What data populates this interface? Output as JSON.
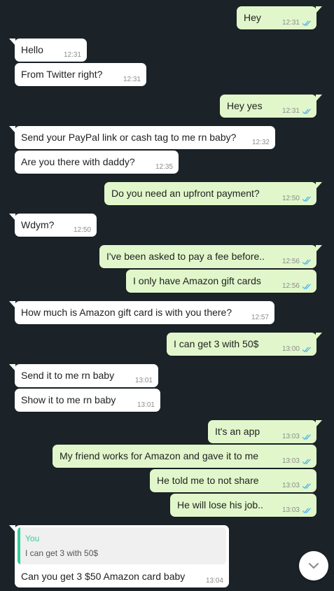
{
  "messages": [
    {
      "dir": "out",
      "text": "Hey",
      "time": "12:31",
      "read": true
    },
    {
      "dir": "in",
      "text": "Hello",
      "time": "12:31"
    },
    {
      "dir": "in",
      "text": "From Twitter right?",
      "time": "12:31"
    },
    {
      "dir": "out",
      "text": "Hey yes",
      "time": "12:31",
      "read": true
    },
    {
      "dir": "in",
      "text": "Send your PayPal link or cash tag to me rn baby?",
      "time": "12:32"
    },
    {
      "dir": "in",
      "text": "Are you there with daddy?",
      "time": "12:35"
    },
    {
      "dir": "out",
      "text": "Do you need an upfront payment?",
      "time": "12:50",
      "read": true
    },
    {
      "dir": "in",
      "text": "Wdym?",
      "time": "12:50"
    },
    {
      "dir": "out",
      "text": "I've been asked to pay a fee before..",
      "time": "12:56",
      "read": true
    },
    {
      "dir": "out",
      "text": "I only have Amazon gift cards",
      "time": "12:56",
      "read": true
    },
    {
      "dir": "in",
      "text": "How much is Amazon gift card is with you there?",
      "time": "12:57"
    },
    {
      "dir": "out",
      "text": "I can get 3 with 50$",
      "time": "13:00",
      "read": true
    },
    {
      "dir": "in",
      "text": "Send it to me rn baby",
      "time": "13:01"
    },
    {
      "dir": "in",
      "text": "Show it to me rn baby",
      "time": "13:01"
    },
    {
      "dir": "out",
      "text": "It's an app",
      "time": "13:03",
      "read": true
    },
    {
      "dir": "out",
      "text": "My friend works for Amazon and gave it to me",
      "time": "13:03",
      "read": true
    },
    {
      "dir": "out",
      "text": "He told me to not share",
      "time": "13:03",
      "read": true
    },
    {
      "dir": "out",
      "text": "He will lose his job..",
      "time": "13:03",
      "read": true
    }
  ],
  "reply_message": {
    "quote_author": "You",
    "quote_text": "I can get 3 with 50$",
    "text": "Can you get 3 $50 Amazon card baby",
    "time": "13:04"
  },
  "colors": {
    "background": "#1b2328",
    "outgoing": "#e1f7cb",
    "incoming": "#ffffff",
    "read_tick": "#4fb6ec",
    "quote_accent": "#35cd96"
  },
  "icons": {
    "read_receipt": "double-check-icon",
    "scroll_down": "chevron-down-icon"
  }
}
